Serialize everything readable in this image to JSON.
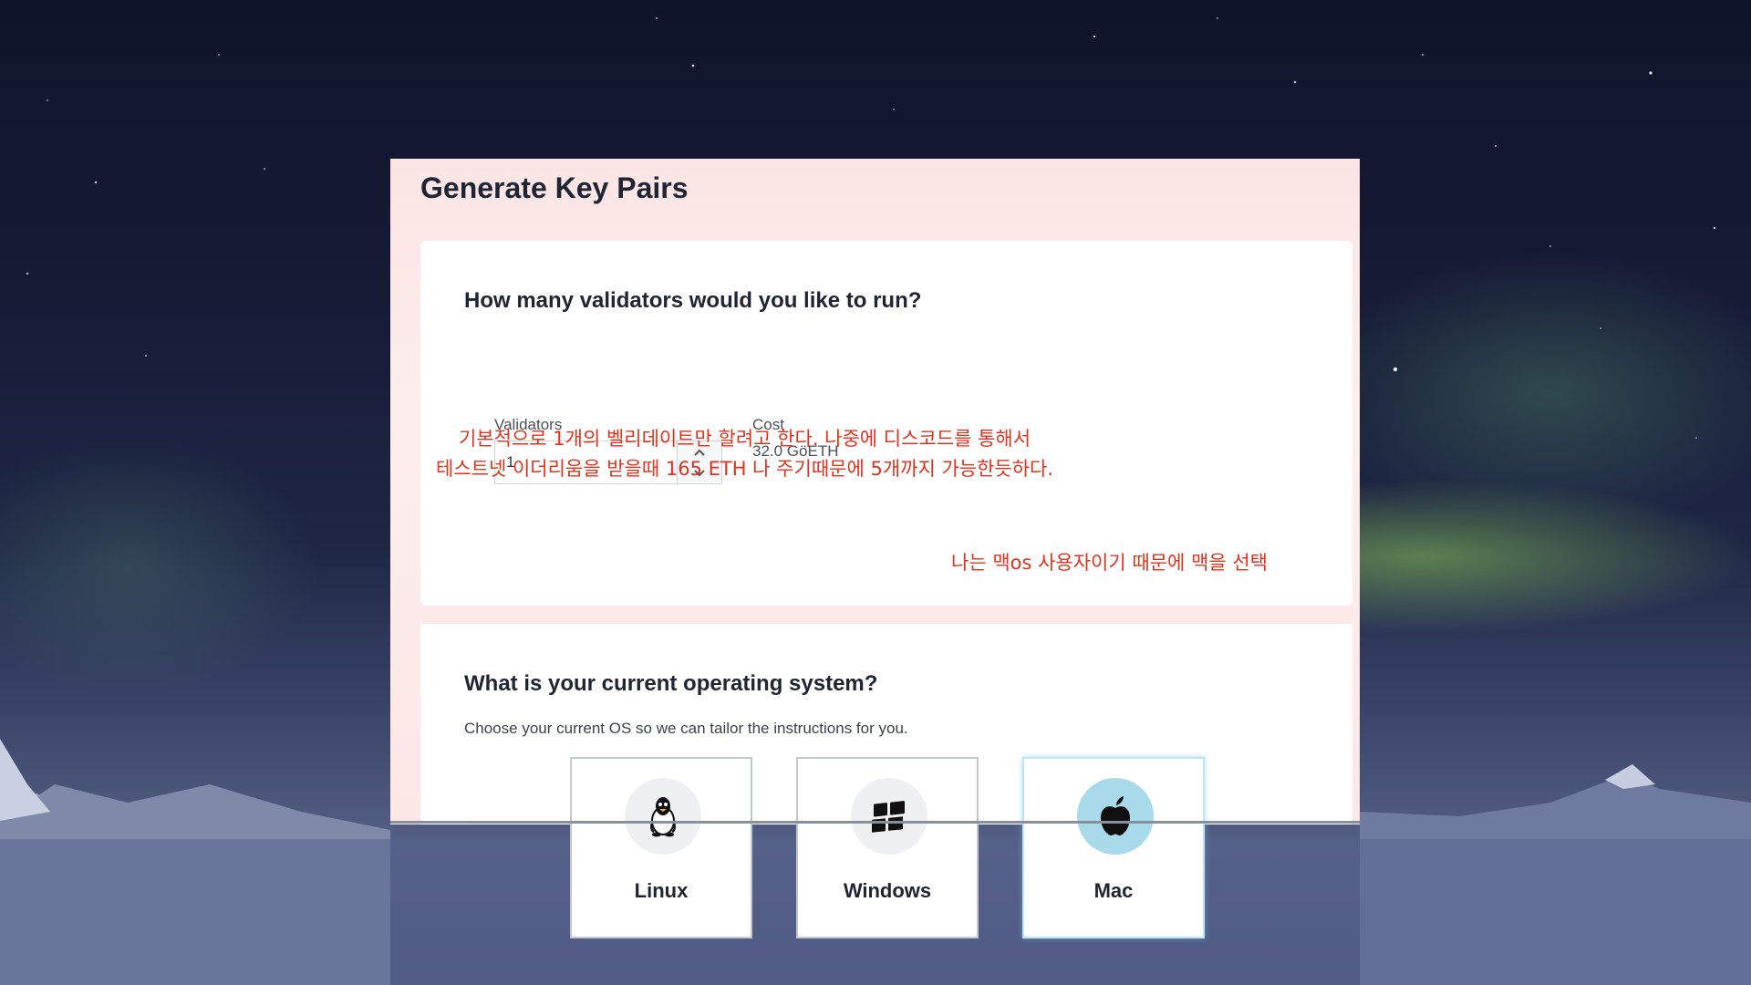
{
  "page": {
    "title": "Generate Key Pairs"
  },
  "validators_section": {
    "question": "How many validators would you like to run?",
    "validators_label": "Validators",
    "validators_value": "1",
    "cost_label": "Cost",
    "cost_value": "32.0 GöETH"
  },
  "annotations": {
    "line1": "기본적으로 1개의 벨리데이트만 할려고 한다. 나중에 디스코드를 통해서",
    "line2": "테스트넷 이더리움을 받을때 165 ETH 나 주기때문에 5개까지 가능한듯하다.",
    "os_note": "나는 맥os 사용자이기 때문에  맥을 선택"
  },
  "os_section": {
    "question": "What is your current operating system?",
    "description": "Choose your current OS so we can tailor the instructions for you.",
    "options": [
      {
        "label": "Linux",
        "icon": "linux-penguin-icon",
        "selected": false
      },
      {
        "label": "Windows",
        "icon": "windows-logo-icon",
        "selected": false
      },
      {
        "label": "Mac",
        "icon": "apple-logo-icon",
        "selected": true
      }
    ]
  },
  "colors": {
    "annotation": "#e0331f",
    "selected_border": "#bfe4f2",
    "selected_circle": "#a8daea"
  }
}
